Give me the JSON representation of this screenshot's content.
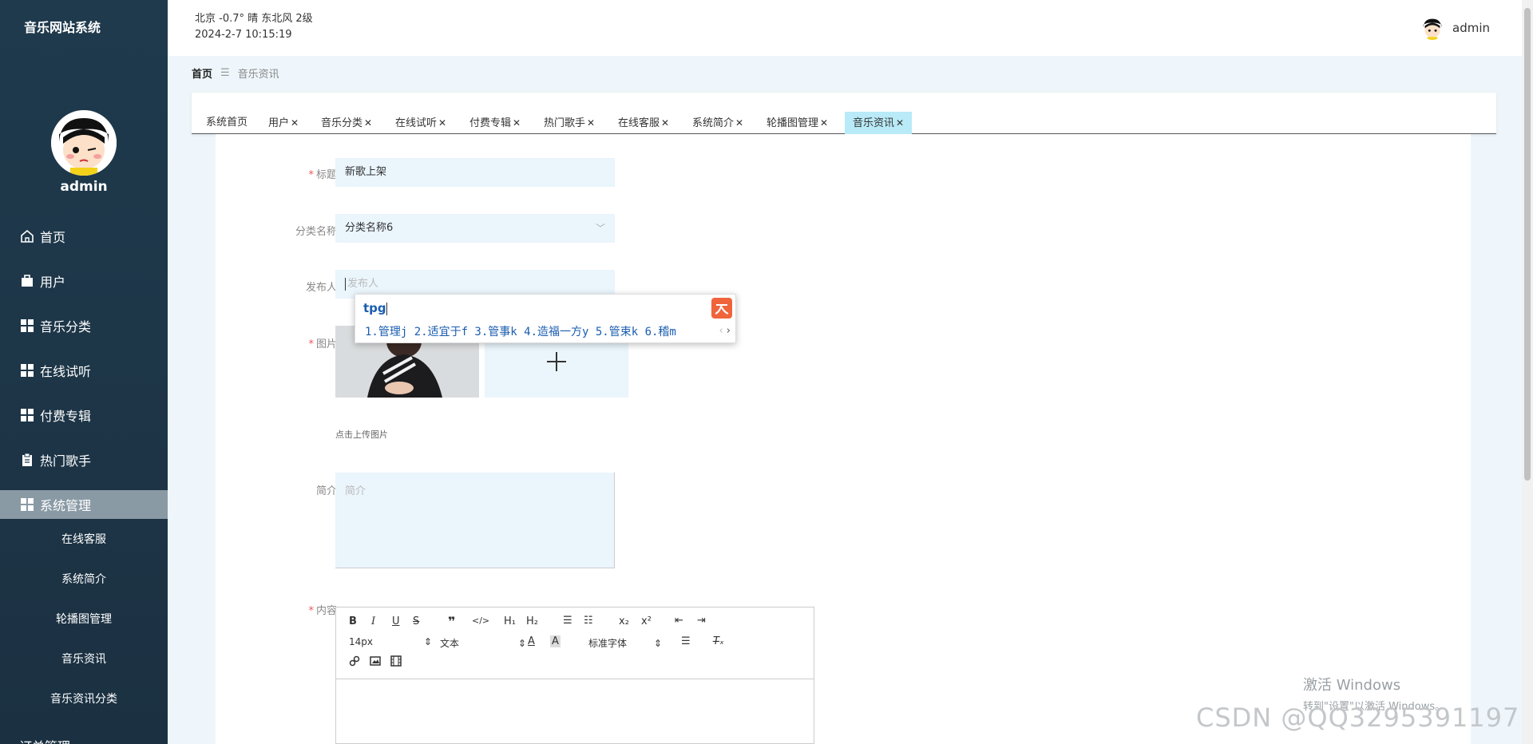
{
  "brand": "音乐网站系统",
  "sidebar": {
    "username": "admin",
    "menu": [
      {
        "label": "首页",
        "icon": "home-icon"
      },
      {
        "label": "用户",
        "icon": "briefcase-icon"
      },
      {
        "label": "音乐分类",
        "icon": "grid-icon"
      },
      {
        "label": "在线试听",
        "icon": "grid-icon"
      },
      {
        "label": "付费专辑",
        "icon": "grid-icon"
      },
      {
        "label": "热门歌手",
        "icon": "clipboard-icon"
      },
      {
        "label": "系统管理",
        "icon": "grid-icon"
      }
    ],
    "submenu": [
      "在线客服",
      "系统简介",
      "轮播图管理",
      "音乐资讯",
      "音乐资讯分类"
    ],
    "bottom_item": "订单管理"
  },
  "topbar": {
    "weather": "北京  -0.7°  晴  东北风  2级",
    "datetime": "2024-2-7 10:15:19",
    "username": "admin"
  },
  "breadcrumb": {
    "home": "首页",
    "separator": "☰",
    "current": "音乐资讯"
  },
  "tabs": [
    {
      "label": "系统首页",
      "closable": false
    },
    {
      "label": "用户",
      "closable": true
    },
    {
      "label": "音乐分类",
      "closable": true
    },
    {
      "label": "在线试听",
      "closable": true
    },
    {
      "label": "付费专辑",
      "closable": true
    },
    {
      "label": "热门歌手",
      "closable": true
    },
    {
      "label": "在线客服",
      "closable": true
    },
    {
      "label": "系统简介",
      "closable": true
    },
    {
      "label": "轮播图管理",
      "closable": true
    },
    {
      "label": "音乐资讯",
      "closable": true,
      "active": true
    }
  ],
  "form": {
    "title": {
      "label": "标题",
      "value": "新歌上架"
    },
    "category": {
      "label": "分类名称",
      "value": "分类名称6"
    },
    "publisher": {
      "label": "发布人",
      "placeholder": "发布人"
    },
    "image": {
      "label": "图片",
      "hint": "点击上传图片"
    },
    "intro": {
      "label": "简介",
      "placeholder": "简介"
    },
    "content": {
      "label": "内容"
    }
  },
  "editor": {
    "font_size": "14px",
    "text_type": "文本",
    "font_family": "标准字体"
  },
  "ime": {
    "input": "tpg",
    "candidates": "1.管理j  2.适宜于f  3.管事k  4.造福一方y  5.管束k  6.稽m"
  },
  "watermark": {
    "windows_title": "激活 Windows",
    "windows_sub": "转到\"设置\"以激活 Windows。",
    "csdn": "CSDN @QQ3295391197"
  }
}
